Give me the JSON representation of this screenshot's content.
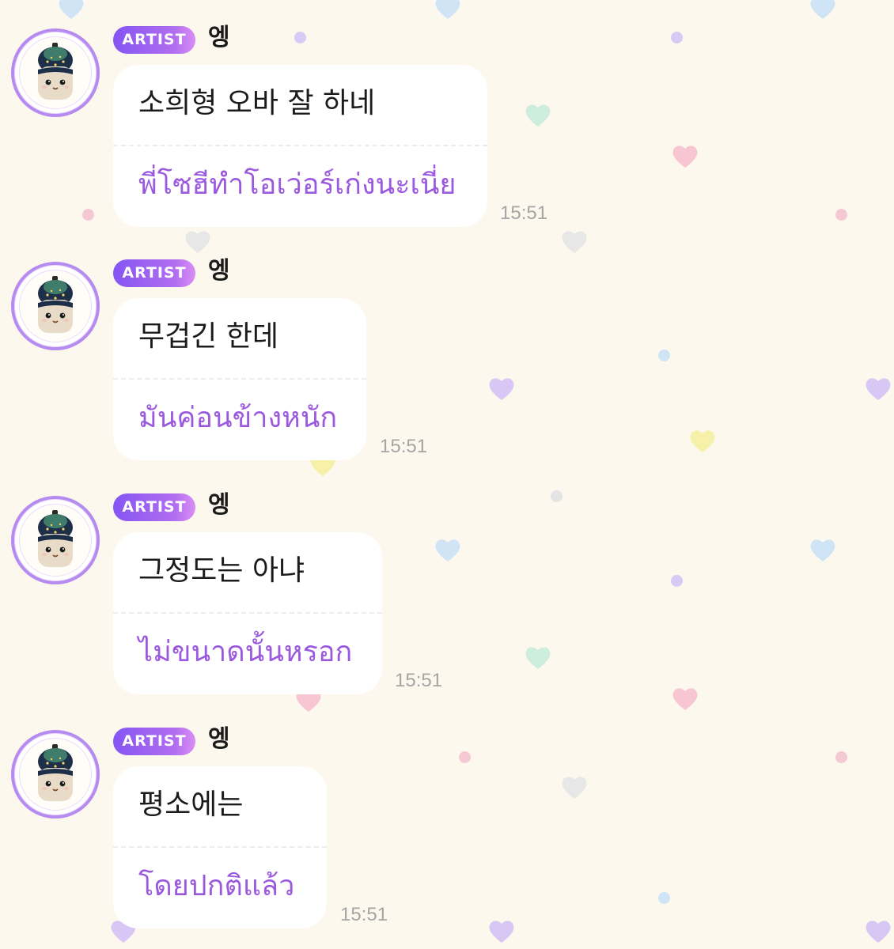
{
  "colors": {
    "background": "#fdf8ee",
    "badge_gradient_start": "#8455f2",
    "badge_gradient_end": "#d98ef6",
    "translation_text": "#9b59e0",
    "timestamp": "#a5a5a5",
    "bubble": "#ffffff"
  },
  "messages": [
    {
      "badge": "ARTIST",
      "sender": "엥",
      "text": "소희형 오바 잘 하네",
      "translation": "พี่โซฮีทำโอเว่อร์เก่งนะเนี่ย",
      "time": "15:51",
      "avatar_icon": "plush-doll-avatar-icon"
    },
    {
      "badge": "ARTIST",
      "sender": "엥",
      "text": "무겁긴 한데",
      "translation": "มันค่อนข้างหนัก",
      "time": "15:51",
      "avatar_icon": "plush-doll-avatar-icon"
    },
    {
      "badge": "ARTIST",
      "sender": "엥",
      "text": "그정도는 아냐",
      "translation": "ไม่ขนาดนั้นหรอก",
      "time": "15:51",
      "avatar_icon": "plush-doll-avatar-icon"
    },
    {
      "badge": "ARTIST",
      "sender": "엥",
      "text": "평소에는",
      "translation": "โดยปกติแล้ว",
      "time": "15:51",
      "avatar_icon": "plush-doll-avatar-icon"
    }
  ]
}
